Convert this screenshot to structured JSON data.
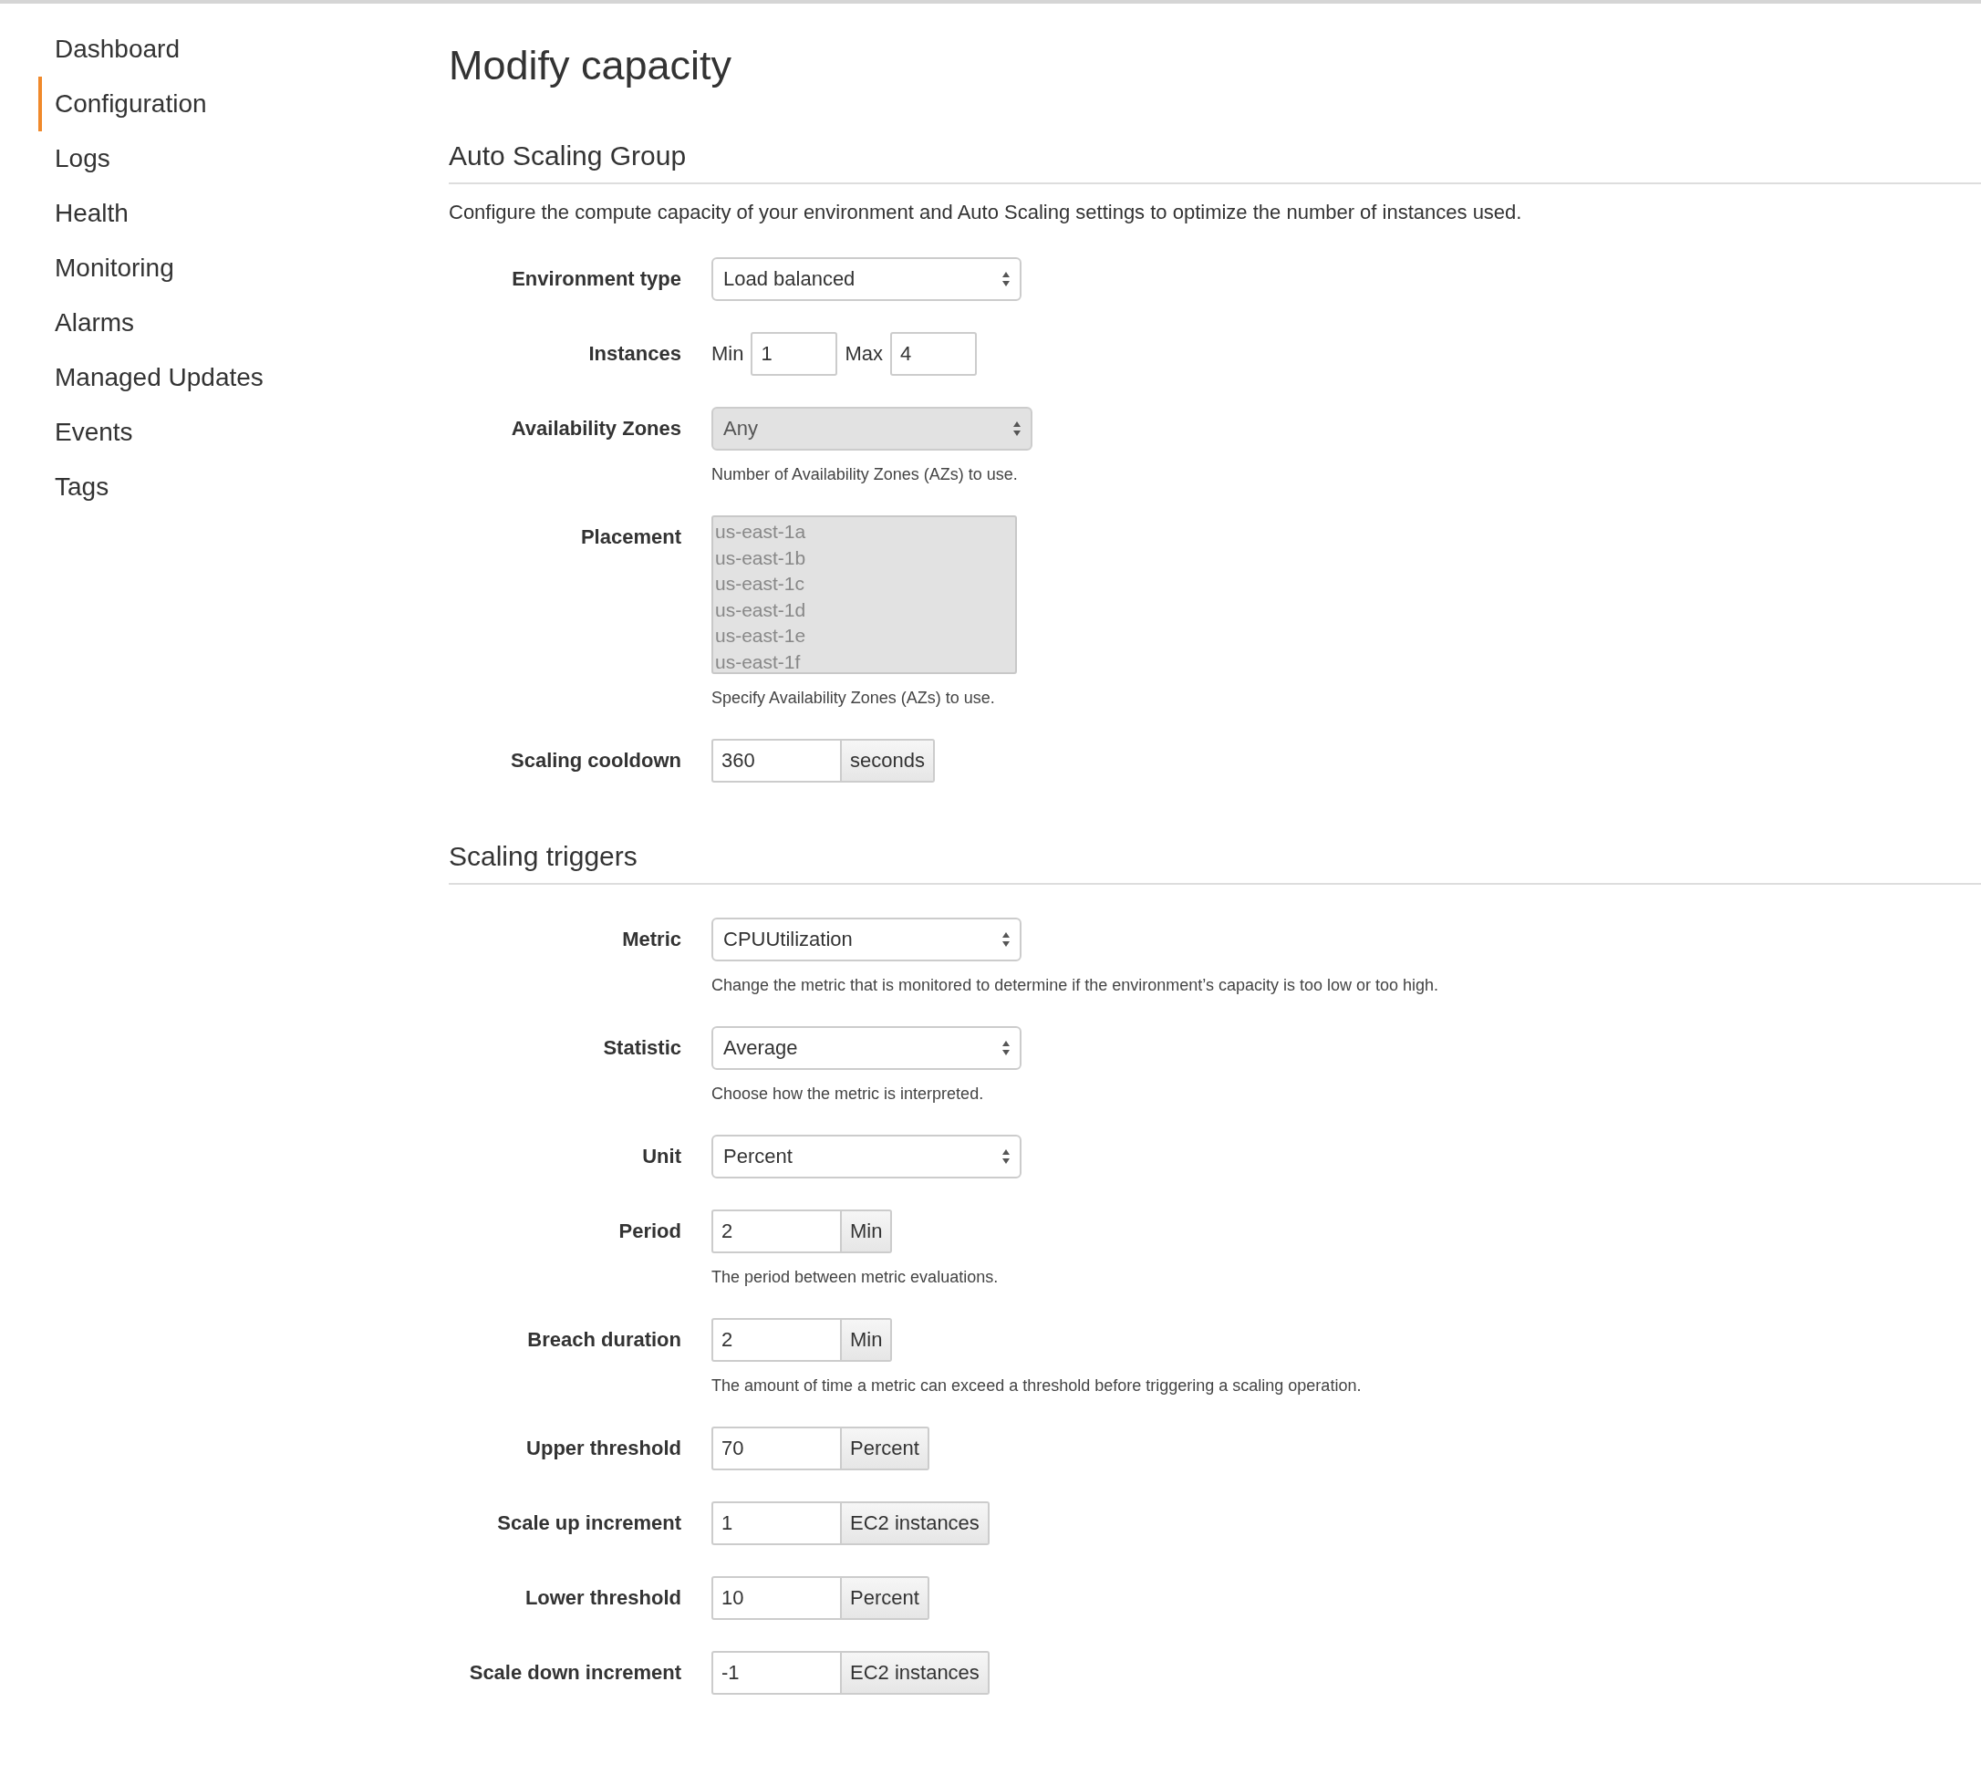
{
  "sidebar": {
    "items": [
      {
        "label": "Dashboard",
        "selected": false
      },
      {
        "label": "Configuration",
        "selected": true
      },
      {
        "label": "Logs",
        "selected": false
      },
      {
        "label": "Health",
        "selected": false
      },
      {
        "label": "Monitoring",
        "selected": false
      },
      {
        "label": "Alarms",
        "selected": false
      },
      {
        "label": "Managed Updates",
        "selected": false
      },
      {
        "label": "Events",
        "selected": false
      },
      {
        "label": "Tags",
        "selected": false
      }
    ]
  },
  "page_title": "Modify capacity",
  "sections": [
    {
      "title": "Auto Scaling Group",
      "description": "Configure the compute capacity of your environment and Auto Scaling settings to optimize the number of instances used.",
      "rows": [
        {
          "kind": "select",
          "label": "Environment type",
          "value": "Load balanced",
          "disabled": false
        },
        {
          "kind": "minmax",
          "label": "Instances",
          "min_label": "Min",
          "min_value": "1",
          "max_label": "Max",
          "max_value": "4"
        },
        {
          "kind": "select",
          "label": "Availability Zones",
          "value": "Any",
          "disabled": true,
          "help": "Number of Availability Zones (AZs) to use."
        },
        {
          "kind": "listbox",
          "label": "Placement",
          "options": [
            "us-east-1a",
            "us-east-1b",
            "us-east-1c",
            "us-east-1d",
            "us-east-1e",
            "us-east-1f"
          ],
          "disabled": true,
          "help": "Specify Availability Zones (AZs) to use."
        },
        {
          "kind": "addon",
          "label": "Scaling cooldown",
          "value": "360",
          "unit": "seconds"
        }
      ]
    },
    {
      "title": "Scaling triggers",
      "rows": [
        {
          "kind": "select",
          "label": "Metric",
          "value": "CPUUtilization",
          "disabled": false,
          "help": "Change the metric that is monitored to determine if the environment’s capacity is too low or too high."
        },
        {
          "kind": "select",
          "label": "Statistic",
          "value": "Average",
          "disabled": false,
          "help": "Choose how the metric is interpreted."
        },
        {
          "kind": "select",
          "label": "Unit",
          "value": "Percent",
          "disabled": false
        },
        {
          "kind": "addon",
          "label": "Period",
          "value": "2",
          "unit": "Min",
          "help": "The period between metric evaluations."
        },
        {
          "kind": "addon",
          "label": "Breach duration",
          "value": "2",
          "unit": "Min",
          "help": "The amount of time a metric can exceed a threshold before triggering a scaling operation."
        },
        {
          "kind": "addon",
          "label": "Upper threshold",
          "value": "70",
          "unit": "Percent"
        },
        {
          "kind": "addon",
          "label": "Scale up increment",
          "value": "1",
          "unit": "EC2 instances"
        },
        {
          "kind": "addon",
          "label": "Lower threshold",
          "value": "10",
          "unit": "Percent"
        },
        {
          "kind": "addon",
          "label": "Scale down increment",
          "value": "-1",
          "unit": "EC2 instances"
        }
      ]
    }
  ]
}
